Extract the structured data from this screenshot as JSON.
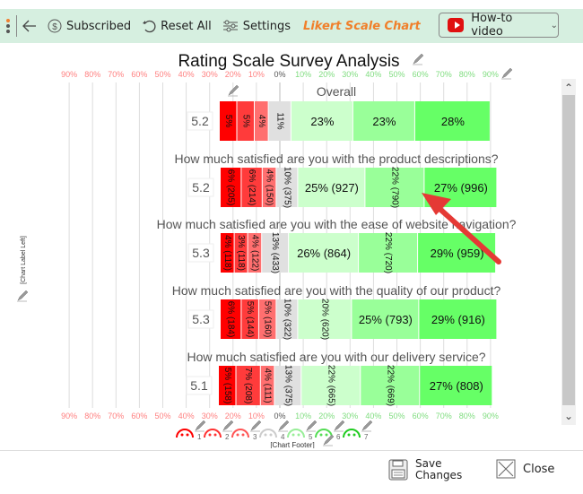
{
  "toolbar": {
    "subscribed": "Subscribed",
    "reset_all": "Reset All",
    "settings": "Settings",
    "app_title": "Likert Scale Chart",
    "howto_video": "How-to video",
    "icons": [
      "menu-dots-icon",
      "back-arrow-icon",
      "dollar-circle-icon",
      "reset-icon",
      "settings-sliders-icon",
      "youtube-icon",
      "chevron-down-icon"
    ]
  },
  "side_label": "[Chart Label Left]",
  "footer_label": "[Chart Footer]",
  "buttons": {
    "save_line1": "Save",
    "save_line2": "Changes",
    "close": "Close"
  },
  "colors": {
    "neg3": "#ff0000",
    "neg2": "#ff3b3b",
    "neg1": "#ff6f6f",
    "neutral": "#e0e0e0",
    "pos1": "#ccffcc",
    "pos2": "#99ff99",
    "pos3": "#66ff66",
    "neg_tick": "#ff8080",
    "pos_tick": "#80dd80",
    "arrow": "#e53935",
    "toolbar_bg": "#d6efe0",
    "title_accent": "#f07f2a"
  },
  "chart_data": {
    "type": "bar",
    "subtype": "diverging-stacked-likert",
    "title": "Rating Scale Survey Analysis",
    "axis_ticks": [
      "90%",
      "80%",
      "70%",
      "60%",
      "50%",
      "40%",
      "30%",
      "20%",
      "10%",
      "0%",
      "10%",
      "20%",
      "30%",
      "40%",
      "50%",
      "60%",
      "70%",
      "80%",
      "90%"
    ],
    "xlim": [
      -90,
      90
    ],
    "scale_points": [
      1,
      2,
      3,
      4,
      5,
      6,
      7
    ],
    "legend": "bottom (face icons 1–7)",
    "rows": [
      {
        "label": "Overall",
        "mean": "5.2",
        "pct": [
          5,
          5,
          4,
          11,
          23,
          23,
          28
        ],
        "counts": null
      },
      {
        "label": "How much satisfied are you with the product descriptions?",
        "mean": "5.2",
        "pct": [
          6,
          6,
          4,
          10,
          25,
          22,
          27
        ],
        "counts": [
          205,
          214,
          150,
          375,
          927,
          790,
          996
        ]
      },
      {
        "label": "How much satisfied are you with the ease of website navigation?",
        "mean": "5.3",
        "pct": [
          4,
          3,
          4,
          13,
          26,
          22,
          29
        ],
        "counts": [
          118,
          118,
          122,
          433,
          864,
          720,
          959
        ]
      },
      {
        "label": "How much satisfied are you with the quality of our product?",
        "mean": "5.3",
        "pct": [
          6,
          5,
          5,
          10,
          20,
          25,
          29
        ],
        "counts": [
          184,
          144,
          160,
          322,
          620,
          793,
          916
        ]
      },
      {
        "label": "How much satisfied are you with our delivery service?",
        "mean": "5.1",
        "pct": [
          5,
          7,
          4,
          13,
          22,
          22,
          27
        ],
        "counts": [
          158,
          208,
          111,
          375,
          665,
          669,
          808
        ]
      }
    ]
  }
}
